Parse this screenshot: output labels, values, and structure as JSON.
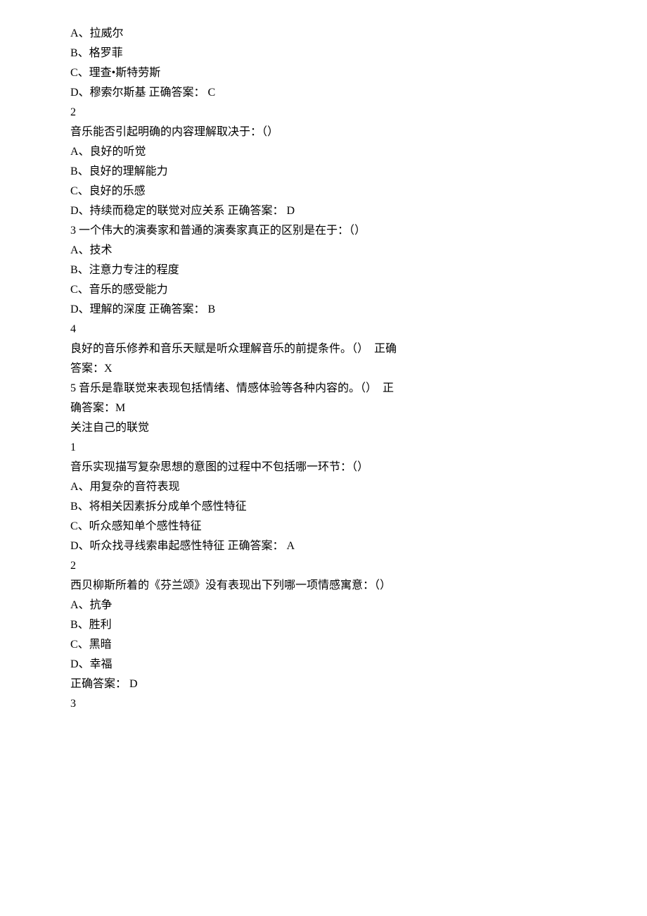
{
  "lines": [
    "A、拉威尔",
    "B、格罗菲",
    "C、理查•斯特劳斯",
    "D、穆索尔斯基 正确答案： C",
    "2",
    "音乐能否引起明确的内容理解取决于：（）",
    "A、良好的听觉",
    "B、良好的理解能力",
    "C、良好的乐感",
    "D、持续而稳定的联觉对应关系 正确答案： D",
    "3 一个伟大的演奏家和普通的演奏家真正的区别是在于：（）",
    "A、技术",
    "B、注意力专注的程度",
    "C、音乐的感受能力",
    "D、理解的深度 正确答案： B",
    "4",
    "良好的音乐修养和音乐天赋是听众理解音乐的前提条件。（）  正确",
    "答案：X",
    "5 音乐是靠联觉来表现包括情绪、情感体验等各种内容的。（）  正",
    "确答案：M",
    "关注自己的联觉",
    "1",
    "音乐实现描写复杂思想的意图的过程中不包括哪一环节：（）",
    "A、用复杂的音符表现",
    "B、将相关因素拆分成单个感性特征",
    "C、听众感知单个感性特征",
    "D、听众找寻线索串起感性特征 正确答案： A",
    "2",
    "西贝柳斯所着的《芬兰颂》没有表现出下列哪一项情感寓意：（）",
    "A、抗争",
    "B、胜利",
    "C、黑暗",
    "D、幸福",
    "正确答案： D",
    "3"
  ]
}
